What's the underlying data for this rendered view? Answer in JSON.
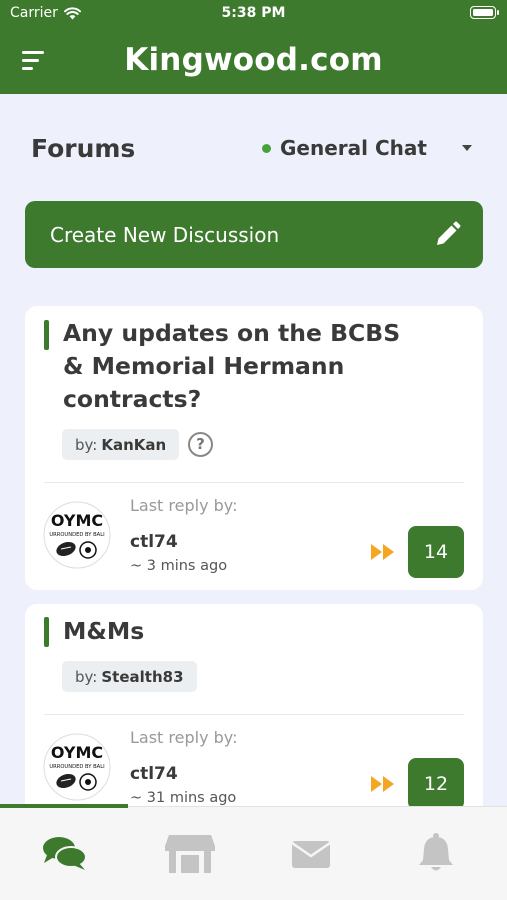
{
  "status": {
    "carrier": "Carrier",
    "time": "5:38 PM"
  },
  "header": {
    "title": "Kingwood.com",
    "menu_icon": "hamburger-icon"
  },
  "forums": {
    "title": "Forums",
    "category": {
      "label": "General Chat",
      "status_color": "#43a33a"
    }
  },
  "create": {
    "label": "Create New Discussion",
    "icon": "pencil-icon"
  },
  "threads": [
    {
      "title_lines": [
        "Any updates on the BCBS",
        "& Memorial Hermann",
        "contracts?"
      ],
      "by_prefix": "by:",
      "author": "KanKan",
      "help_symbol": "?",
      "reply_label": "Last reply by:",
      "reply_user": "ctl74",
      "reply_time": "~ 3 mins ago",
      "reply_count": "14"
    },
    {
      "title_lines": [
        "M&Ms"
      ],
      "by_prefix": "by:",
      "author": "Stealth83",
      "reply_label": "Last reply by:",
      "reply_user": "ctl74",
      "reply_time": "~ 31 mins ago",
      "reply_count": "12"
    }
  ],
  "avatar": {
    "line1": "OYMC",
    "line2": "URROUNDED BY BALI"
  },
  "tabs": [
    {
      "name": "forums",
      "icon": "chat-bubbles-icon",
      "active": true
    },
    {
      "name": "marketplace",
      "icon": "storefront-icon",
      "active": false
    },
    {
      "name": "messages",
      "icon": "envelope-icon",
      "active": false
    },
    {
      "name": "notifications",
      "icon": "bell-icon",
      "active": false
    }
  ],
  "colors": {
    "brand_green": "#3e7a2e",
    "background": "#eef1fb",
    "fast_forward": "#f5a623",
    "inactive_icon": "#c4c4c4"
  }
}
